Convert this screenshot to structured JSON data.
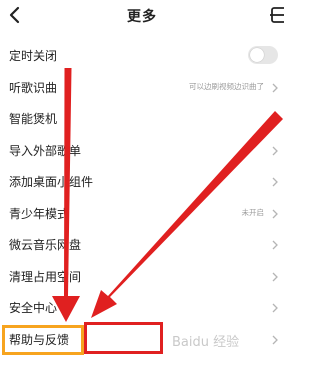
{
  "header": {
    "title": "更多"
  },
  "settings": {
    "items": [
      {
        "label": "定时关闭"
      },
      {
        "label": "听歌识曲",
        "hint": "可以边刷视频边识曲了"
      },
      {
        "label": "智能煲机"
      },
      {
        "label": "导入外部歌单"
      },
      {
        "label": "添加桌面小组件"
      },
      {
        "label": "青少年模式",
        "hint": "未开启"
      },
      {
        "label": "微云音乐网盘"
      },
      {
        "label": "清理占用空间"
      },
      {
        "label": "安全中心"
      },
      {
        "label": "帮助与反馈"
      }
    ],
    "sleep_timer_on": false
  },
  "watermark": {
    "text": "Baidu 经验"
  },
  "annotation_color": "#e02020",
  "highlight_color": "#f7a41f"
}
